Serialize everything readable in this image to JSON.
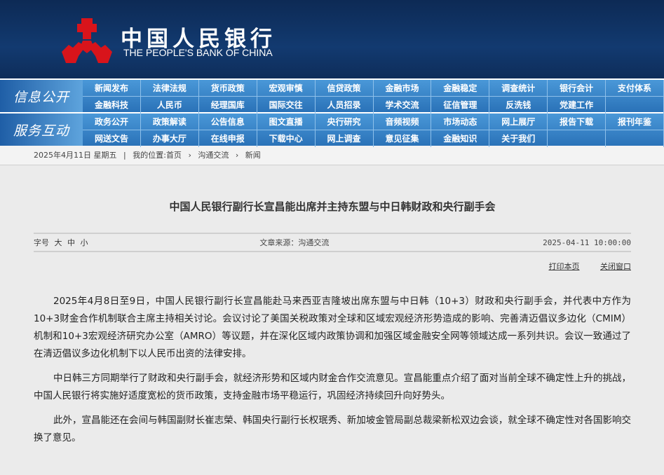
{
  "header": {
    "title_cn": "中国人民银行",
    "title_en": "THE PEOPLE'S BANK OF CHINA"
  },
  "nav": [
    {
      "label": "信息公开",
      "items": [
        "新闻发布",
        "法律法规",
        "货币政策",
        "宏观审慎",
        "信贷政策",
        "金融市场",
        "金融稳定",
        "调查统计",
        "银行会计",
        "支付体系",
        "金融科技",
        "人民币",
        "经理国库",
        "国际交往",
        "人员招录",
        "学术交流",
        "征信管理",
        "反洗钱",
        "党建工作",
        ""
      ]
    },
    {
      "label": "服务互动",
      "items": [
        "政务公开",
        "政策解读",
        "公告信息",
        "图文直播",
        "央行研究",
        "音频视频",
        "市场动态",
        "网上展厅",
        "报告下载",
        "报刊年鉴",
        "网送文告",
        "办事大厅",
        "在线申报",
        "下载中心",
        "网上调查",
        "意见征集",
        "金融知识",
        "关于我们",
        "",
        ""
      ]
    }
  ],
  "breadcrumb": {
    "date": "2025年4月11日 星期五",
    "sep": "|",
    "location": "我的位置:",
    "items": [
      "首页",
      "沟通交流",
      "新闻"
    ],
    "arrow": "›"
  },
  "article": {
    "title": "中国人民银行副行长宣昌能出席并主持东盟与中日韩财政和央行副手会",
    "font_label": "字号",
    "font_sizes": [
      "大",
      "中",
      "小"
    ],
    "source": "文章来源：沟通交流",
    "datetime": "2025-04-11 10:00:00",
    "print": "打印本页",
    "close": "关闭窗口",
    "paragraphs": [
      "2025年4月8日至9日，中国人民银行副行长宣昌能赴马来西亚吉隆坡出席东盟与中日韩（10+3）财政和央行副手会，并代表中方作为10+3财金合作机制联合主席主持相关讨论。会议讨论了美国关税政策对全球和区域宏观经济形势造成的影响、完善清迈倡议多边化（CMIM）机制和10+3宏观经济研究办公室（AMRO）等议题，并在深化区域内政策协调和加强区域金融安全网等领域达成一系列共识。会议一致通过了在清迈倡议多边化机制下以人民币出资的法律安排。",
      "中日韩三方同期举行了财政和央行副手会，就经济形势和区域内财金合作交流意见。宣昌能重点介绍了面对当前全球不确定性上升的挑战，中国人民银行将实施好适度宽松的货币政策，支持金融市场平稳运行，巩固经济持续回升向好势头。",
      "此外，宣昌能还在会间与韩国副财长崔志榮、韩国央行副行长权珉秀、新加坡金管局副总裁梁新松双边会谈，就全球不确定性对各国影响交换了意见。"
    ]
  },
  "colors": {
    "header": "#123a70",
    "nav": "#2f7ec4",
    "logo": "#d8141b"
  }
}
